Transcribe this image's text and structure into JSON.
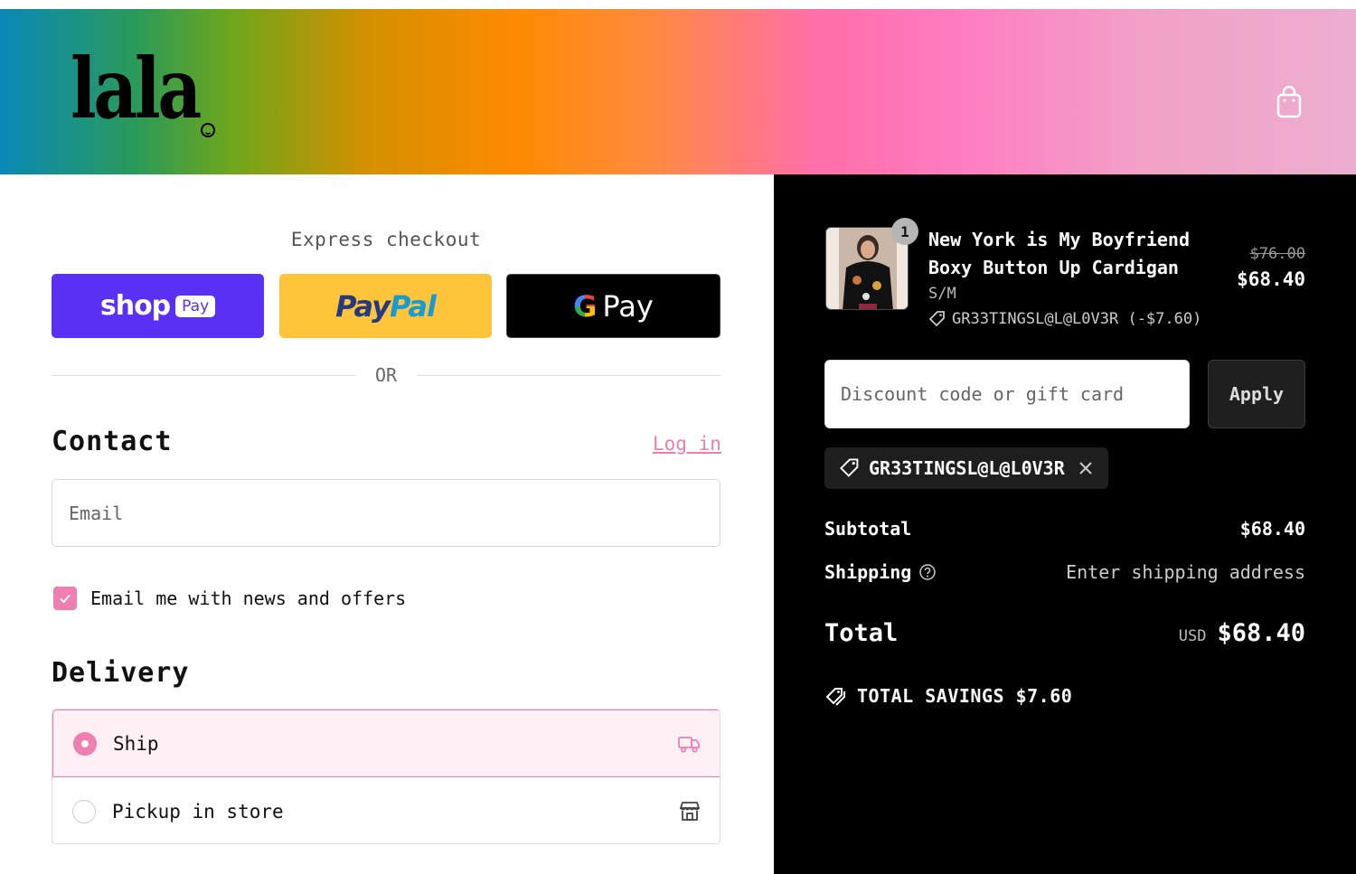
{
  "header": {
    "logo_text": "lala",
    "cart_icon": "shopping-bag-icon"
  },
  "express": {
    "title": "Express checkout",
    "shop_pay_label": "shop",
    "shop_pay_badge": "Pay",
    "paypal_dark": "Pay",
    "paypal_light": "Pal",
    "gpay_g": "G",
    "gpay_label": "Pay",
    "or_label": "OR"
  },
  "contact": {
    "heading": "Contact",
    "login_label": "Log in",
    "email_placeholder": "Email",
    "newsletter_label": "Email me with news and offers",
    "newsletter_checked": true
  },
  "delivery": {
    "heading": "Delivery",
    "options": [
      {
        "label": "Ship",
        "selected": true,
        "icon": "truck-icon"
      },
      {
        "label": "Pickup in store",
        "selected": false,
        "icon": "store-icon"
      }
    ]
  },
  "summary": {
    "item": {
      "quantity": "1",
      "name": "New York is My Boyfriend Boxy Button Up Cardigan",
      "variant": "S/M",
      "discount": "GR33TINGSL@L@L0V3R (-$7.60)",
      "original_price": "$76.00",
      "price": "$68.40"
    },
    "discount_placeholder": "Discount code or gift card",
    "apply_label": "Apply",
    "applied_code": "GR33TINGSL@L@L0V3R",
    "subtotal_label": "Subtotal",
    "subtotal_value": "$68.40",
    "shipping_label": "Shipping",
    "shipping_value": "Enter shipping address",
    "total_label": "Total",
    "currency": "USD",
    "total_value": "$68.40",
    "savings_label": "TOTAL SAVINGS $7.60"
  },
  "colors": {
    "accent_pink": "#ef7fb0",
    "shop_pay": "#5a31f4",
    "paypal": "#ffc439"
  }
}
